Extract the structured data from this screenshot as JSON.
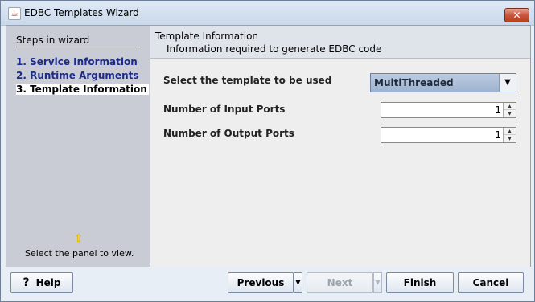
{
  "window": {
    "title": "EDBC Templates Wizard",
    "close_label": "✕"
  },
  "steps": {
    "header": "Steps in wizard",
    "items": [
      {
        "label": "1. Service Information"
      },
      {
        "label": "2. Runtime Arguments"
      },
      {
        "label": "3. Template Information"
      }
    ],
    "hint": "Select the panel to view."
  },
  "info": {
    "title": "Template Information",
    "subtitle": "Information required to generate EDBC code"
  },
  "form": {
    "template_label": "Select the template to be used",
    "template_value": "MultiThreaded",
    "input_ports_label": "Number of Input Ports",
    "input_ports_value": "1",
    "output_ports_label": "Number of Output Ports",
    "output_ports_value": "1"
  },
  "buttons": {
    "help": "Help",
    "previous": "Previous",
    "next": "Next",
    "finish": "Finish",
    "cancel": "Cancel"
  },
  "icons": {
    "help": "help-icon",
    "hint_arrow": "up-arrow-icon"
  }
}
